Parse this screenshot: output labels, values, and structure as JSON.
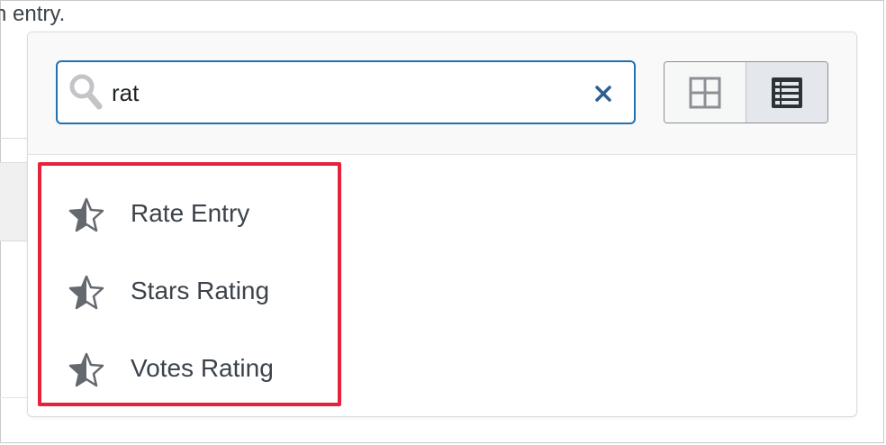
{
  "background": {
    "partial_text": "n entry."
  },
  "search": {
    "value": "rat",
    "placeholder": "",
    "clear_icon": "close-icon",
    "search_icon": "search-icon"
  },
  "view_toggle": {
    "options": [
      {
        "name": "grid",
        "icon": "grid-icon",
        "active": false
      },
      {
        "name": "list",
        "icon": "list-icon",
        "active": true
      }
    ]
  },
  "results": [
    {
      "label": "Rate Entry",
      "icon": "star-half-icon"
    },
    {
      "label": "Stars Rating",
      "icon": "star-half-icon"
    },
    {
      "label": "Votes Rating",
      "icon": "star-half-icon"
    }
  ],
  "colors": {
    "accent": "#2271b1",
    "highlight": "#e5243b",
    "icon": "#646970"
  }
}
